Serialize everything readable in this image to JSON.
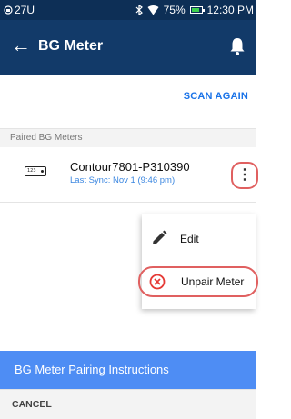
{
  "status_bar": {
    "left_text": "27U",
    "battery_text": "75%",
    "battery_level": 0.75,
    "time": "12:30 PM"
  },
  "app_bar": {
    "back_icon": "arrow-left-icon",
    "title": "BG Meter",
    "bell_icon": "bell-icon"
  },
  "scan_again_label": "SCAN AGAIN",
  "section_header": "Paired BG Meters",
  "meter": {
    "icon_text": "123",
    "name": "Contour7801-P310390",
    "last_sync": "Last Sync: Nov 1 (9:46 pm)",
    "more_icon": "more-vertical-icon"
  },
  "menu": {
    "edit_label": "Edit",
    "edit_icon": "pencil-icon",
    "unpair_label": "Unpair Meter",
    "unpair_icon": "circle-x-icon"
  },
  "pairing_instructions_label": "BG Meter Pairing Instructions",
  "cancel_label": "CANCEL",
  "colors": {
    "status_bar": "#0d2f56",
    "app_bar": "#123a69",
    "accent_blue": "#1a73e8",
    "pairing_bar": "#4e8df4",
    "highlight_red": "#e06060"
  }
}
